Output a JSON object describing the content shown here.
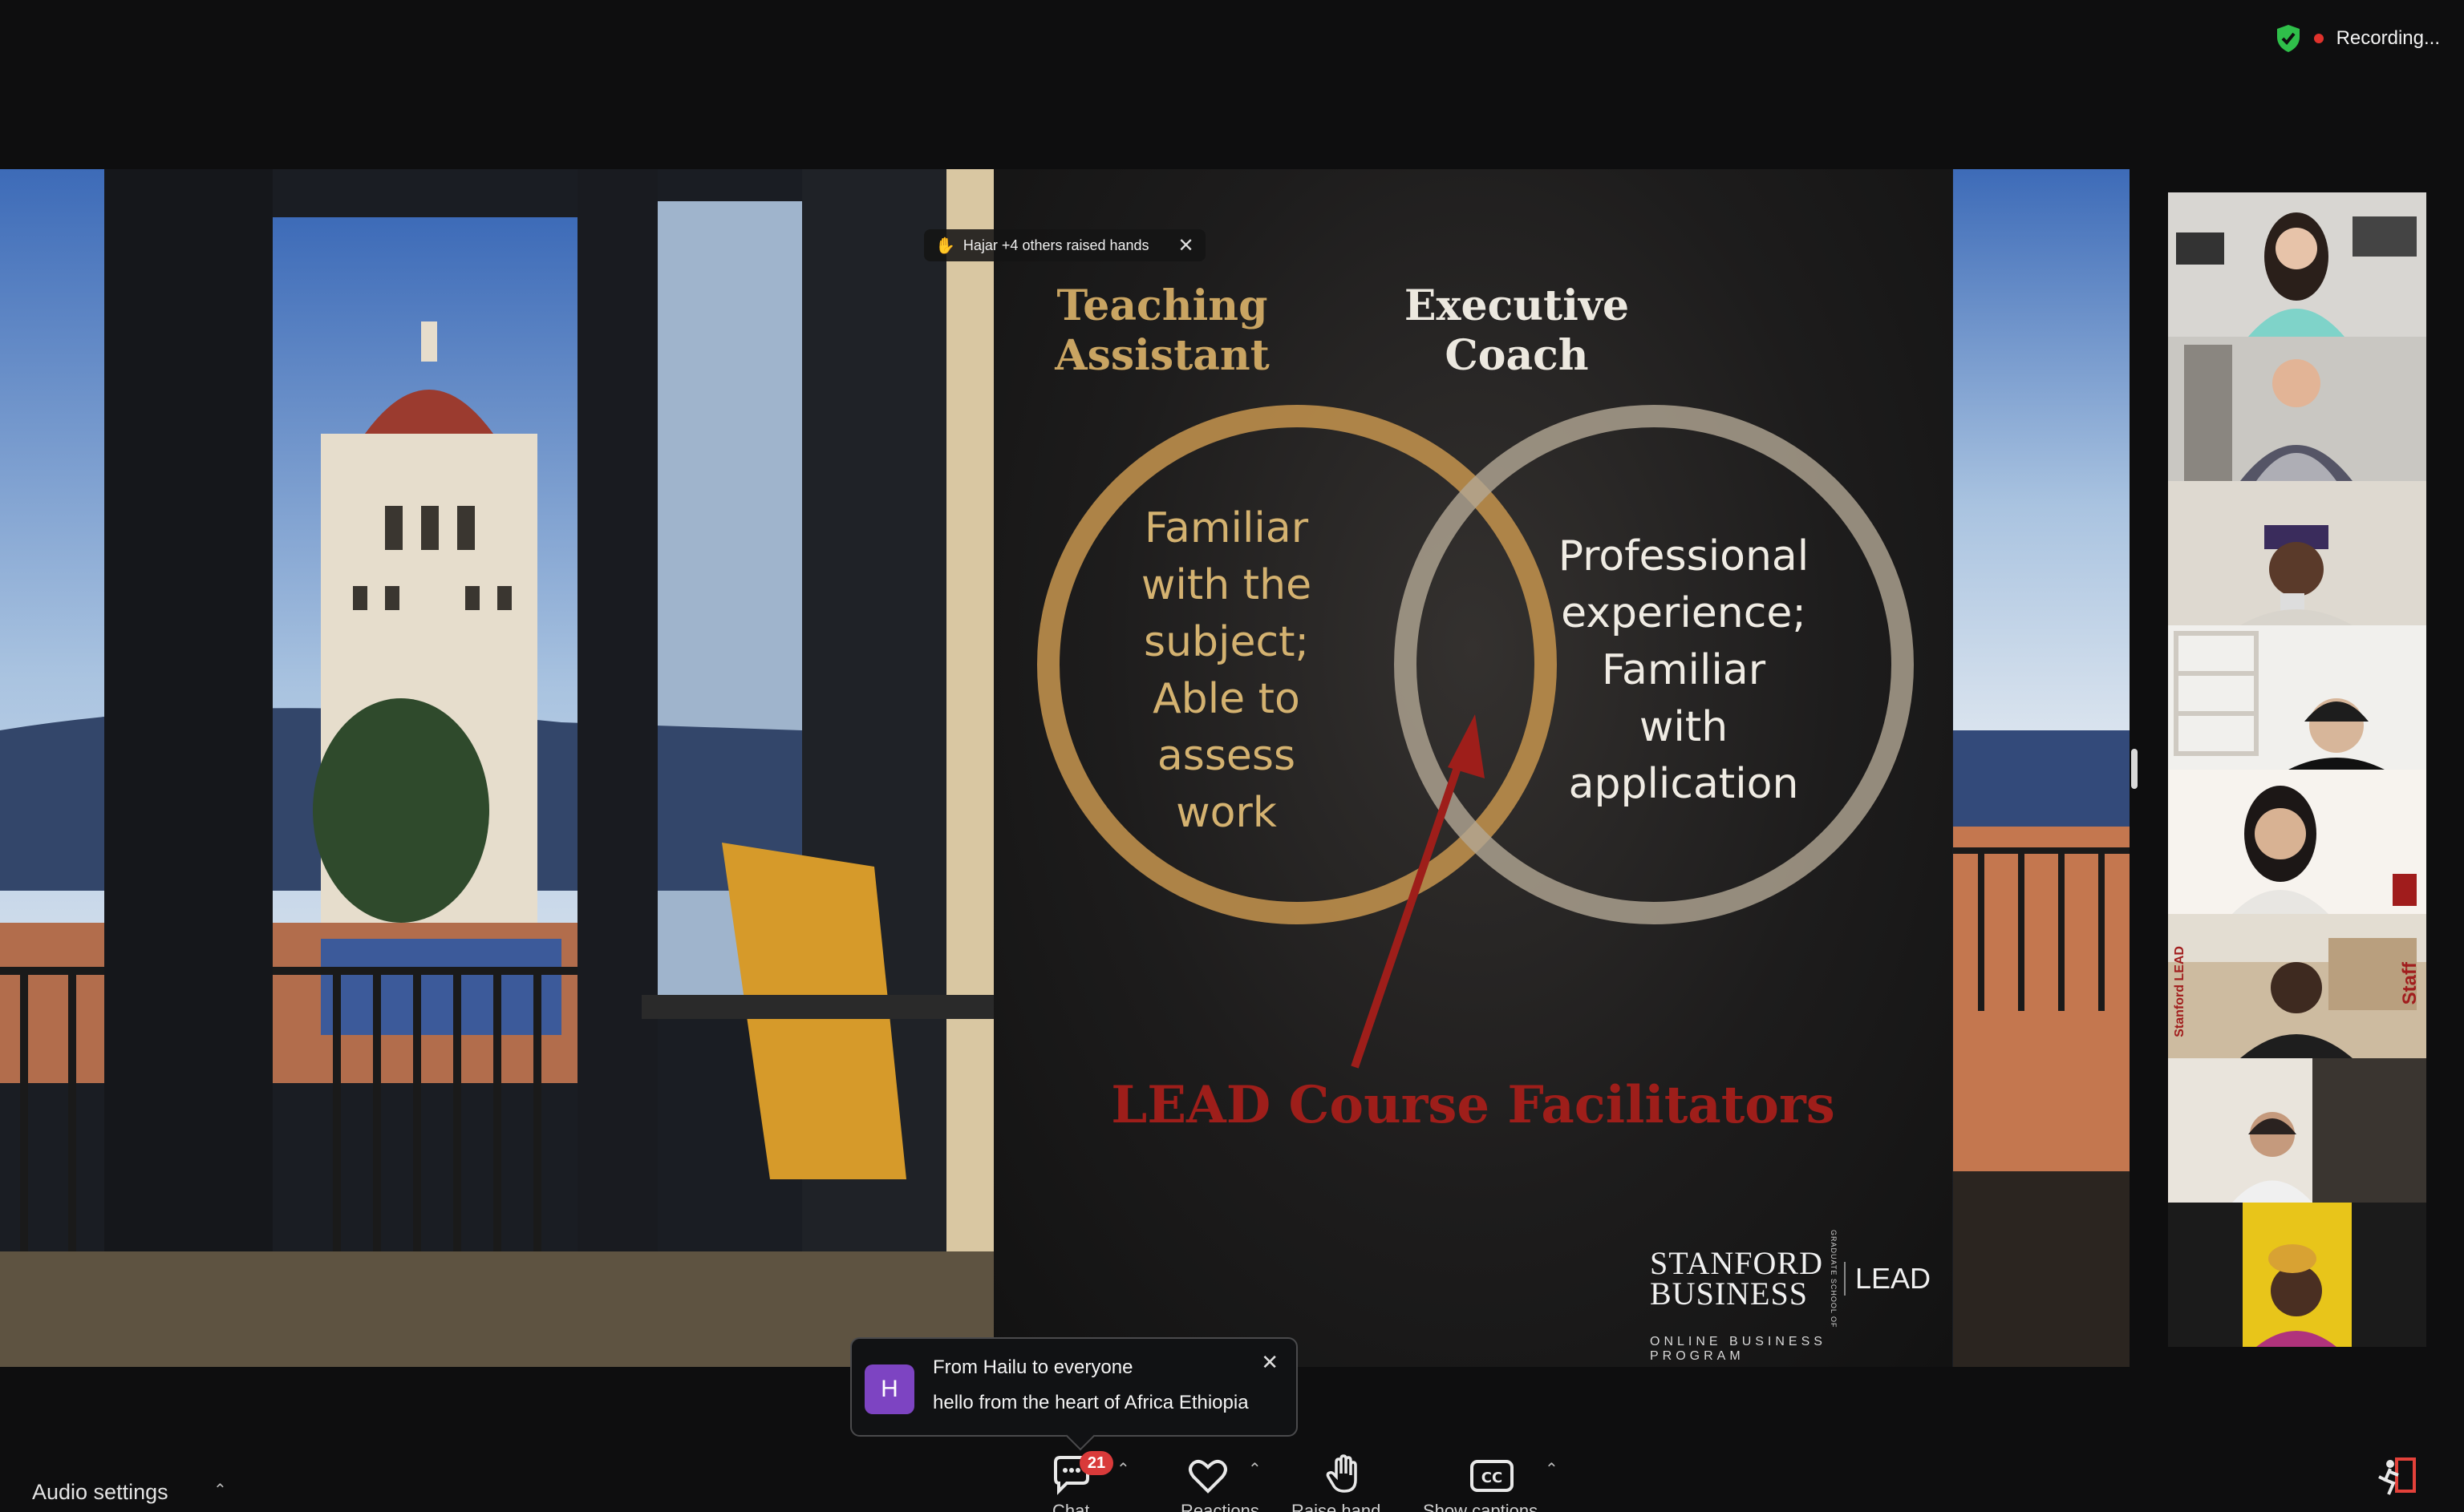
{
  "status": {
    "recording_text": "Recording...",
    "shield_icon": "green-shield-check-icon",
    "colors": {
      "shield": "#2fbf4a",
      "rec_dot": "#e0322c"
    }
  },
  "notification_hands": {
    "text": "Hajar +4 others raised hands",
    "icon": "raised-hand-emoji"
  },
  "slide": {
    "left_heading": [
      "Teaching",
      "Assistant"
    ],
    "right_heading": [
      "Executive",
      "Coach"
    ],
    "left_circle_lines": [
      "Familiar",
      "with the",
      "subject;",
      "Able to",
      "assess",
      "work"
    ],
    "right_circle_lines": [
      "Professional",
      "experience;",
      "Familiar",
      "with",
      "application"
    ],
    "center_label": "LEAD Course Facilitators",
    "logo": {
      "line1": "STANFORD",
      "line2": "BUSINESS",
      "vertical": "GRADUATE SCHOOL OF",
      "lead": "LEAD",
      "subtitle": "ONLINE BUSINESS PROGRAM"
    },
    "colors": {
      "gold": "#c9a462",
      "cream": "#ece8df",
      "red": "#9e1e1a"
    }
  },
  "gallery": {
    "participants": [
      {
        "name": "participant-1",
        "active": false
      },
      {
        "name": "participant-2",
        "active": true
      },
      {
        "name": "participant-3",
        "active": false
      },
      {
        "name": "participant-4",
        "active": false
      },
      {
        "name": "participant-5",
        "active": false
      },
      {
        "name": "participant-6",
        "active": false,
        "side_labels": [
          "Stanford LEAD",
          "Staff"
        ]
      },
      {
        "name": "participant-7",
        "active": false
      },
      {
        "name": "participant-8",
        "active": false
      }
    ],
    "active_color": "#2fd04a"
  },
  "chat_toast": {
    "avatar_initial": "H",
    "from": "From Hailu to everyone",
    "message": "hello from the heart of Africa Ethiopia",
    "avatar_color": "#7d44c2"
  },
  "toolbar": {
    "audio_settings": "Audio settings",
    "chat_badge": "21",
    "icons": [
      "chat-icon",
      "reactions-heart-icon",
      "raise-hand-icon",
      "closed-caption-icon",
      "leave-icon"
    ],
    "cut_off_labels": [
      "Chat",
      "Reactions",
      "Raise hand",
      "Show captions"
    ]
  }
}
